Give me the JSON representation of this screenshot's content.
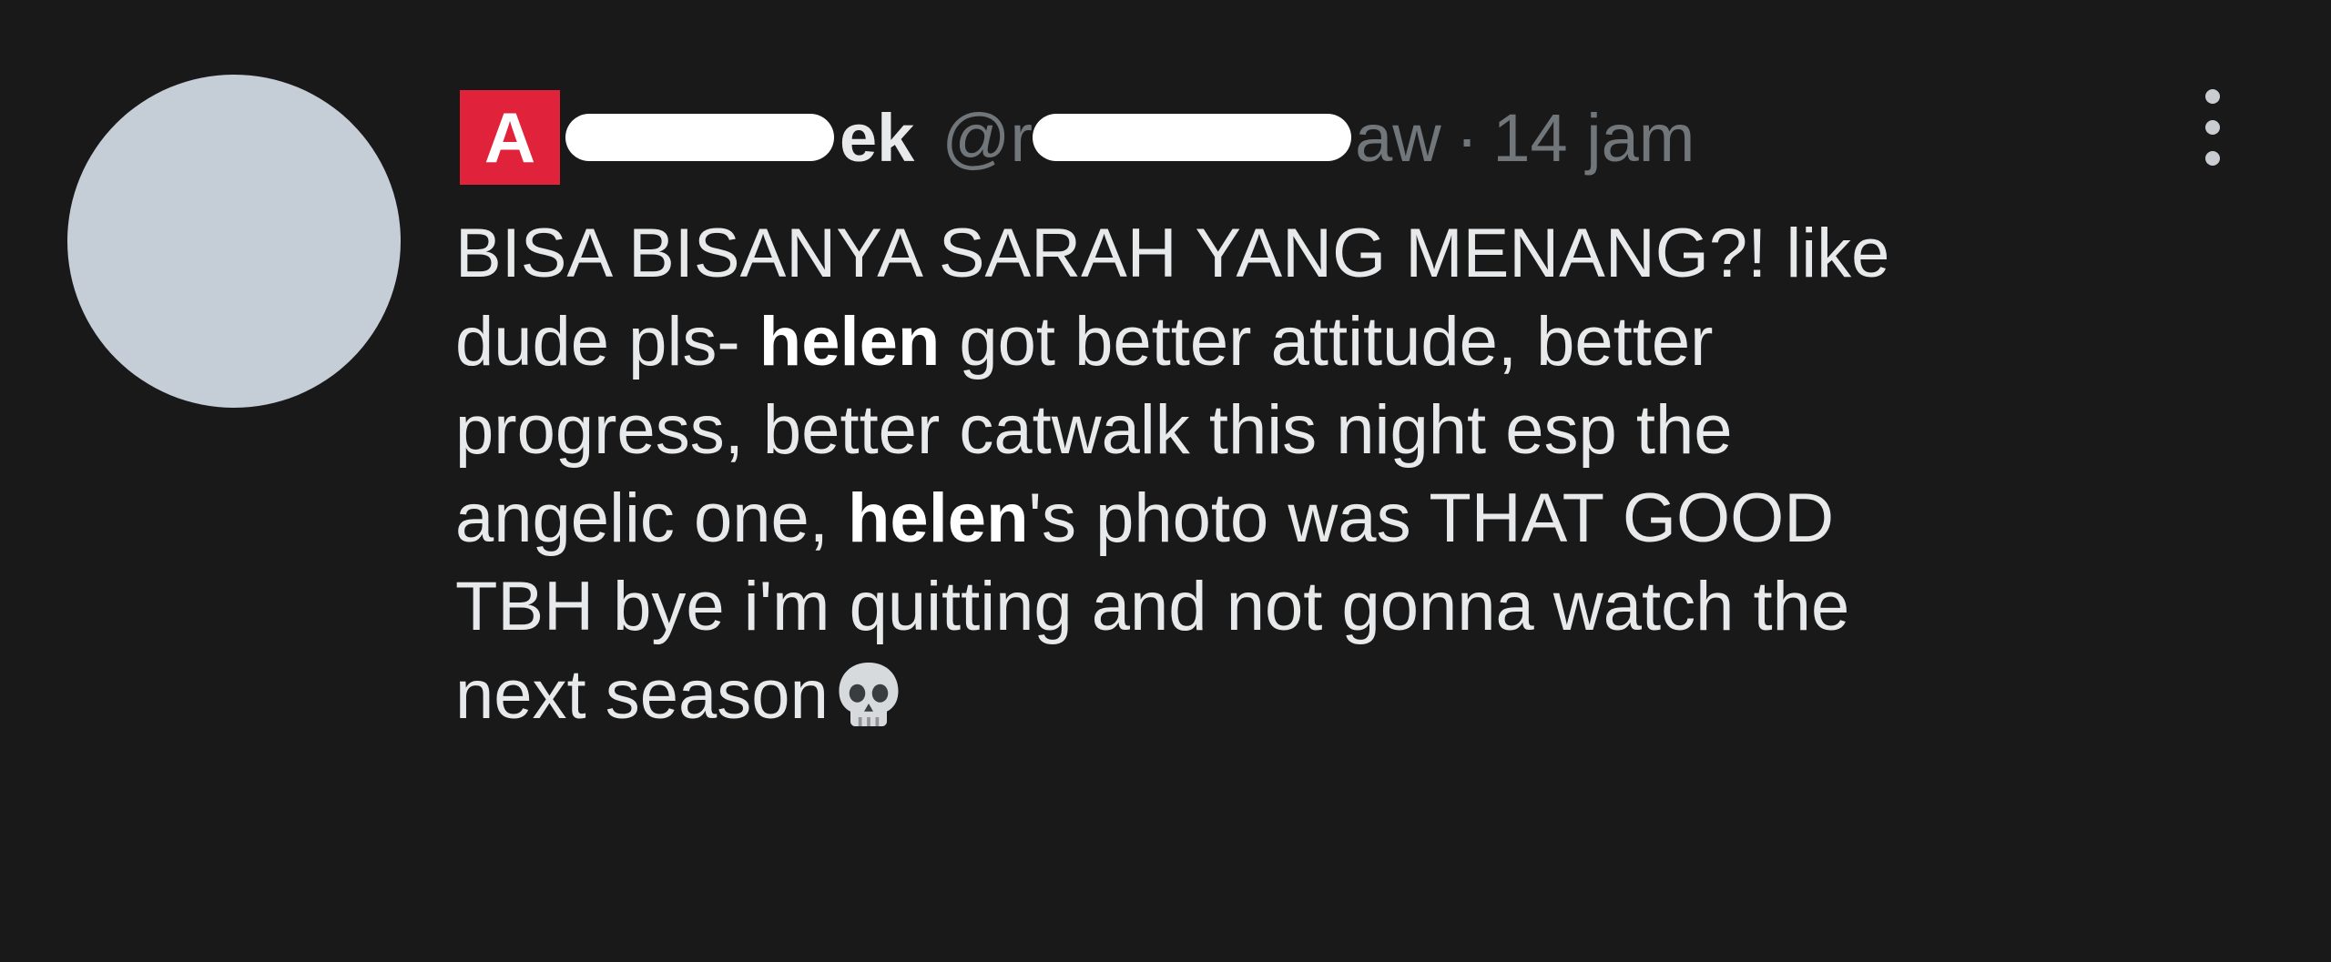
{
  "tweet": {
    "display_name_end": "ek",
    "handle_start": "@r",
    "handle_end": "aw",
    "time_separator": "·",
    "timestamp": "14 jam",
    "badge_letter": "A",
    "body_lines": [
      [
        "BISA BISANYA SARAH YANG MENANG?! like"
      ],
      [
        "dude pls- ",
        "helen",
        " got better attitude, better"
      ],
      [
        "progress, better catwalk this night esp the"
      ],
      [
        "angelic one, ",
        "helen",
        "'s photo was THAT GOOD"
      ],
      [
        "TBH bye i'm quitting and not gonna watch the"
      ],
      [
        "next season"
      ]
    ],
    "emoji": "skull-emoji",
    "colors": {
      "background": "#191919",
      "badge": "#e0223b",
      "avatar": "#c5cdd6",
      "muted": "#71767b"
    }
  }
}
